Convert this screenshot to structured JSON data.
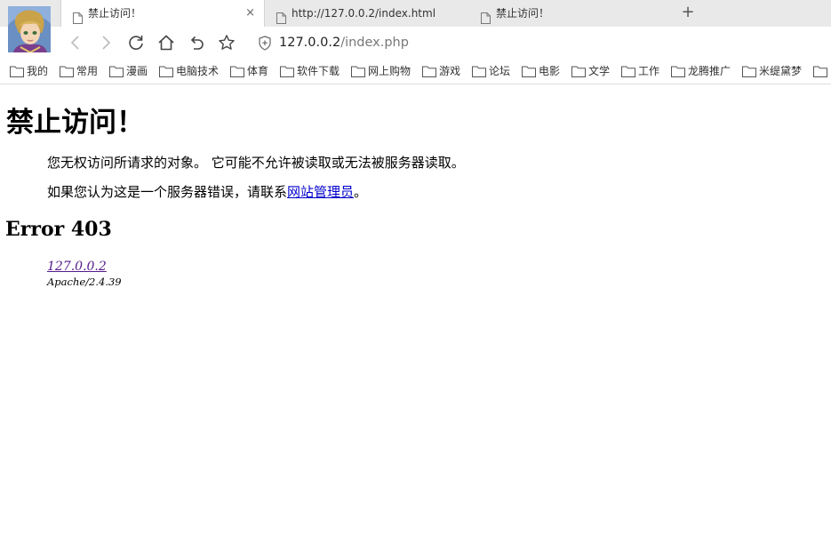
{
  "tabs": [
    {
      "title": "禁止访问！",
      "active": true,
      "close_icon": "×"
    },
    {
      "title": "http://127.0.0.2/index.html",
      "active": false
    },
    {
      "title": "禁止访问！",
      "active": false
    }
  ],
  "newtab_icon": "+",
  "address": {
    "host": "127.0.0.2",
    "path": "/index.php"
  },
  "bookmarks": [
    "我的",
    "常用",
    "漫画",
    "电脑技术",
    "体育",
    "软件下载",
    "网上购物",
    "游戏",
    "论坛",
    "电影",
    "文学",
    "工作",
    "龙腾推广",
    "米缇黛梦"
  ],
  "page": {
    "heading": "禁止访问！",
    "message": "您无权访问所请求的对象。 它可能不允许被读取或无法被服务器读取。",
    "contact_prefix": "如果您认为这是一个服务器错误，请联系",
    "contact_link": "网站管理员",
    "contact_suffix": "。",
    "error_title": "Error 403",
    "server_host": "127.0.0.2",
    "server_software": "Apache/2.4.39"
  }
}
